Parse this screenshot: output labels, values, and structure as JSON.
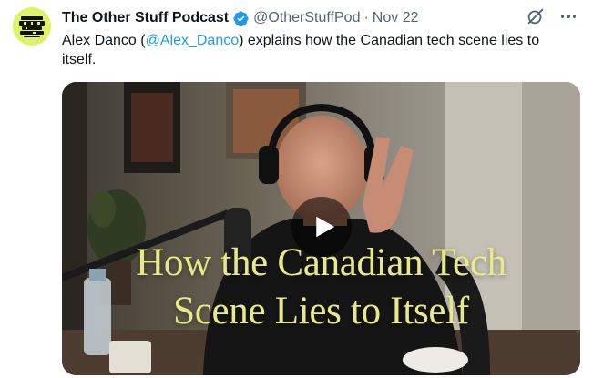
{
  "tweet": {
    "display_name": "The Other Stuff Podcast",
    "handle": "@OtherStuffPod",
    "separator": "·",
    "date": "Nov 22",
    "text_before": "Alex Danco (",
    "mention": "@Alex_Danco",
    "text_after": ") explains how the Canadian tech scene lies to itself."
  },
  "media": {
    "overlay_line1": "How the Canadian Tech",
    "overlay_line2": "Scene Lies to Itself"
  },
  "colors": {
    "accent": "#1d9bf0",
    "text": "#0f1419",
    "muted": "#536471",
    "overlay_text": "#e8e989",
    "avatar_bg": "#dff26a"
  },
  "icons": [
    "verified-badge-icon",
    "grok-icon",
    "more-icon",
    "play-icon"
  ]
}
